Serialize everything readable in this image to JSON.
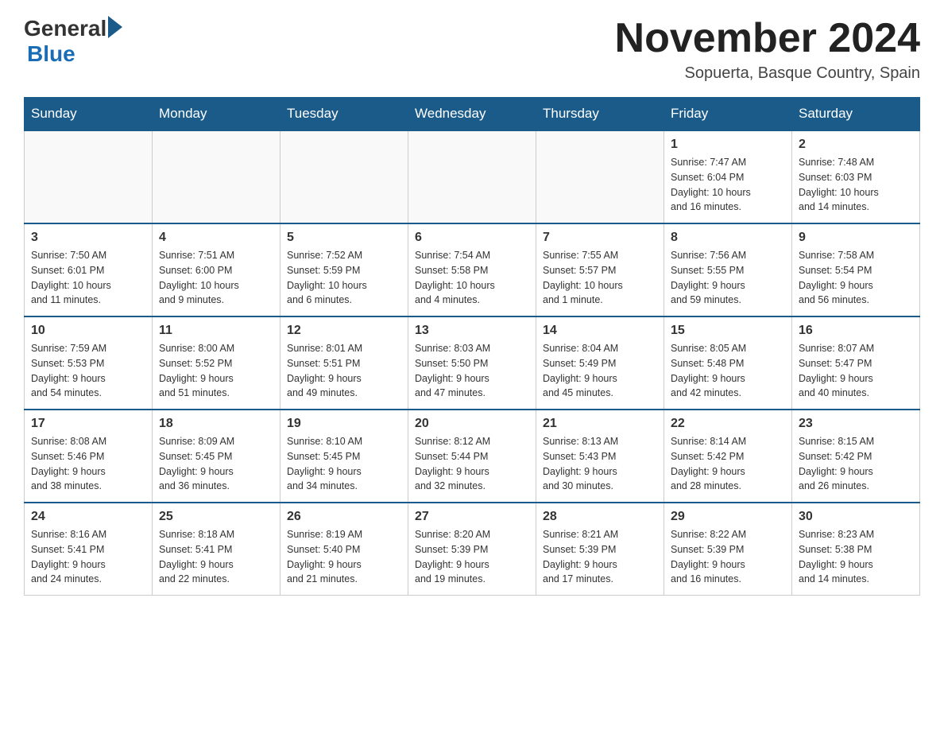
{
  "header": {
    "title": "November 2024",
    "location": "Sopuerta, Basque Country, Spain",
    "logo": {
      "general": "General",
      "blue": "Blue"
    }
  },
  "calendar": {
    "days_of_week": [
      "Sunday",
      "Monday",
      "Tuesday",
      "Wednesday",
      "Thursday",
      "Friday",
      "Saturday"
    ],
    "weeks": [
      [
        {
          "day": "",
          "info": ""
        },
        {
          "day": "",
          "info": ""
        },
        {
          "day": "",
          "info": ""
        },
        {
          "day": "",
          "info": ""
        },
        {
          "day": "",
          "info": ""
        },
        {
          "day": "1",
          "info": "Sunrise: 7:47 AM\nSunset: 6:04 PM\nDaylight: 10 hours\nand 16 minutes."
        },
        {
          "day": "2",
          "info": "Sunrise: 7:48 AM\nSunset: 6:03 PM\nDaylight: 10 hours\nand 14 minutes."
        }
      ],
      [
        {
          "day": "3",
          "info": "Sunrise: 7:50 AM\nSunset: 6:01 PM\nDaylight: 10 hours\nand 11 minutes."
        },
        {
          "day": "4",
          "info": "Sunrise: 7:51 AM\nSunset: 6:00 PM\nDaylight: 10 hours\nand 9 minutes."
        },
        {
          "day": "5",
          "info": "Sunrise: 7:52 AM\nSunset: 5:59 PM\nDaylight: 10 hours\nand 6 minutes."
        },
        {
          "day": "6",
          "info": "Sunrise: 7:54 AM\nSunset: 5:58 PM\nDaylight: 10 hours\nand 4 minutes."
        },
        {
          "day": "7",
          "info": "Sunrise: 7:55 AM\nSunset: 5:57 PM\nDaylight: 10 hours\nand 1 minute."
        },
        {
          "day": "8",
          "info": "Sunrise: 7:56 AM\nSunset: 5:55 PM\nDaylight: 9 hours\nand 59 minutes."
        },
        {
          "day": "9",
          "info": "Sunrise: 7:58 AM\nSunset: 5:54 PM\nDaylight: 9 hours\nand 56 minutes."
        }
      ],
      [
        {
          "day": "10",
          "info": "Sunrise: 7:59 AM\nSunset: 5:53 PM\nDaylight: 9 hours\nand 54 minutes."
        },
        {
          "day": "11",
          "info": "Sunrise: 8:00 AM\nSunset: 5:52 PM\nDaylight: 9 hours\nand 51 minutes."
        },
        {
          "day": "12",
          "info": "Sunrise: 8:01 AM\nSunset: 5:51 PM\nDaylight: 9 hours\nand 49 minutes."
        },
        {
          "day": "13",
          "info": "Sunrise: 8:03 AM\nSunset: 5:50 PM\nDaylight: 9 hours\nand 47 minutes."
        },
        {
          "day": "14",
          "info": "Sunrise: 8:04 AM\nSunset: 5:49 PM\nDaylight: 9 hours\nand 45 minutes."
        },
        {
          "day": "15",
          "info": "Sunrise: 8:05 AM\nSunset: 5:48 PM\nDaylight: 9 hours\nand 42 minutes."
        },
        {
          "day": "16",
          "info": "Sunrise: 8:07 AM\nSunset: 5:47 PM\nDaylight: 9 hours\nand 40 minutes."
        }
      ],
      [
        {
          "day": "17",
          "info": "Sunrise: 8:08 AM\nSunset: 5:46 PM\nDaylight: 9 hours\nand 38 minutes."
        },
        {
          "day": "18",
          "info": "Sunrise: 8:09 AM\nSunset: 5:45 PM\nDaylight: 9 hours\nand 36 minutes."
        },
        {
          "day": "19",
          "info": "Sunrise: 8:10 AM\nSunset: 5:45 PM\nDaylight: 9 hours\nand 34 minutes."
        },
        {
          "day": "20",
          "info": "Sunrise: 8:12 AM\nSunset: 5:44 PM\nDaylight: 9 hours\nand 32 minutes."
        },
        {
          "day": "21",
          "info": "Sunrise: 8:13 AM\nSunset: 5:43 PM\nDaylight: 9 hours\nand 30 minutes."
        },
        {
          "day": "22",
          "info": "Sunrise: 8:14 AM\nSunset: 5:42 PM\nDaylight: 9 hours\nand 28 minutes."
        },
        {
          "day": "23",
          "info": "Sunrise: 8:15 AM\nSunset: 5:42 PM\nDaylight: 9 hours\nand 26 minutes."
        }
      ],
      [
        {
          "day": "24",
          "info": "Sunrise: 8:16 AM\nSunset: 5:41 PM\nDaylight: 9 hours\nand 24 minutes."
        },
        {
          "day": "25",
          "info": "Sunrise: 8:18 AM\nSunset: 5:41 PM\nDaylight: 9 hours\nand 22 minutes."
        },
        {
          "day": "26",
          "info": "Sunrise: 8:19 AM\nSunset: 5:40 PM\nDaylight: 9 hours\nand 21 minutes."
        },
        {
          "day": "27",
          "info": "Sunrise: 8:20 AM\nSunset: 5:39 PM\nDaylight: 9 hours\nand 19 minutes."
        },
        {
          "day": "28",
          "info": "Sunrise: 8:21 AM\nSunset: 5:39 PM\nDaylight: 9 hours\nand 17 minutes."
        },
        {
          "day": "29",
          "info": "Sunrise: 8:22 AM\nSunset: 5:39 PM\nDaylight: 9 hours\nand 16 minutes."
        },
        {
          "day": "30",
          "info": "Sunrise: 8:23 AM\nSunset: 5:38 PM\nDaylight: 9 hours\nand 14 minutes."
        }
      ]
    ]
  }
}
